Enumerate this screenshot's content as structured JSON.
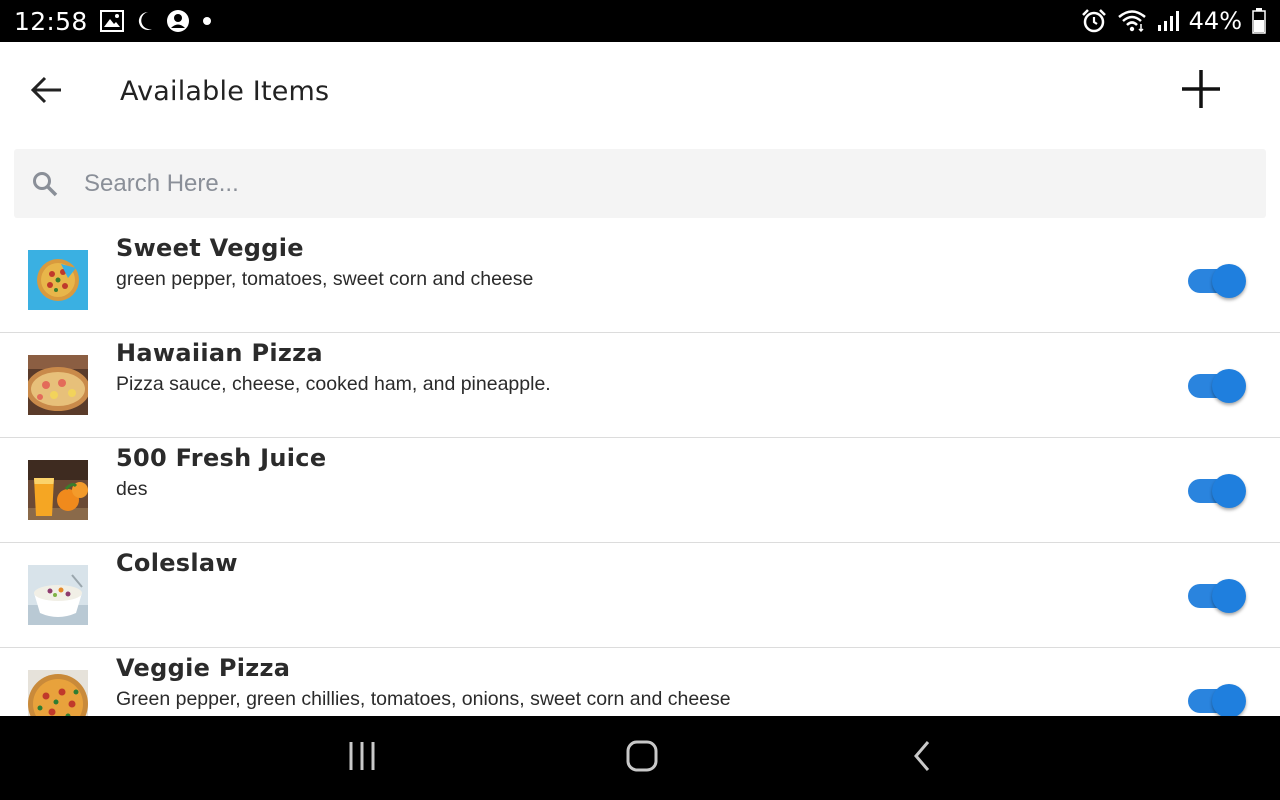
{
  "status_bar": {
    "time": "12:58",
    "battery": "44%",
    "icons": [
      "image-icon",
      "do-not-disturb-moon-icon",
      "account-icon",
      "dot-icon",
      "alarm-icon",
      "wifi-icon",
      "signal-icon",
      "battery-icon"
    ]
  },
  "app_bar": {
    "title": "Available Items",
    "back_icon": "arrow-left-icon",
    "add_icon": "plus-icon"
  },
  "search": {
    "placeholder": "Search Here...",
    "value": ""
  },
  "items": [
    {
      "name": "Sweet Veggie",
      "description": "green pepper, tomatoes, sweet corn and cheese",
      "available": true,
      "thumb": "pizza-top-view-image"
    },
    {
      "name": "Hawaiian Pizza",
      "description": "Pizza sauce, cheese, cooked ham, and pineapple.",
      "available": true,
      "thumb": "hawaiian-pizza-image"
    },
    {
      "name": "500 Fresh Juice",
      "description": "des",
      "available": true,
      "thumb": "orange-juice-image"
    },
    {
      "name": "Coleslaw",
      "description": "",
      "available": true,
      "thumb": "coleslaw-bowl-image"
    },
    {
      "name": "Veggie Pizza",
      "description": "Green pepper, green chillies, tomatoes, onions, sweet corn and cheese",
      "available": true,
      "thumb": "veggie-pizza-image"
    }
  ],
  "nav_bar": {
    "buttons": [
      "recent-apps-icon",
      "home-icon",
      "back-chevron-icon"
    ]
  },
  "colors": {
    "accent": "#1f7fde",
    "status_bar_bg": "#000000",
    "search_bg": "#f4f4f4",
    "divider": "#dcdcdc"
  }
}
